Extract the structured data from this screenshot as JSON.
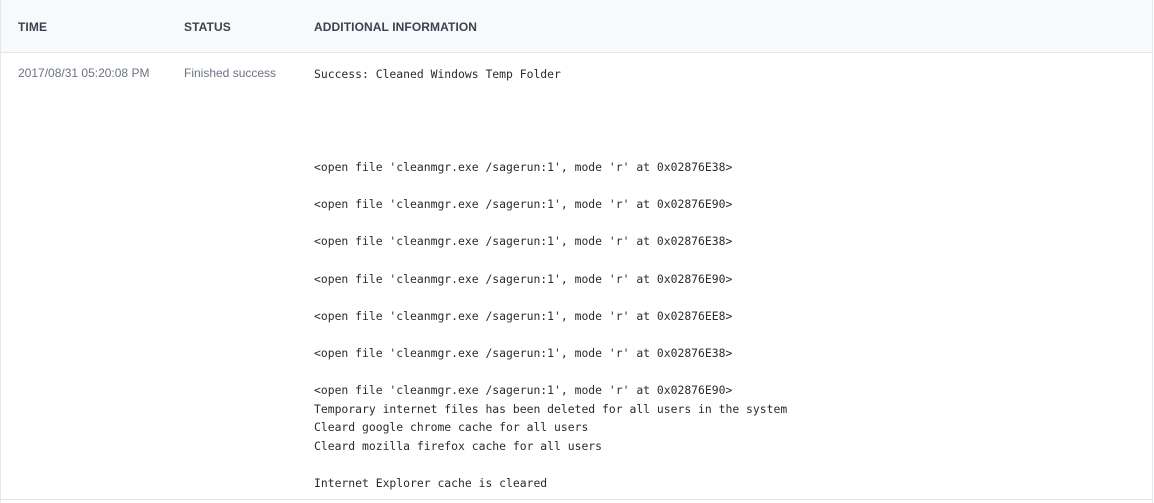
{
  "table": {
    "headers": {
      "time": "TIME",
      "status": "STATUS",
      "additional_information": "ADDITIONAL INFORMATION"
    },
    "rows": [
      {
        "time": "2017/08/31 05:20:08 PM",
        "status": "Finished success",
        "additional_information_lines": [
          "Success: Cleaned Windows Temp Folder",
          "",
          "",
          "",
          "",
          "<open file 'cleanmgr.exe /sagerun:1', mode 'r' at 0x02876E38>",
          "",
          "<open file 'cleanmgr.exe /sagerun:1', mode 'r' at 0x02876E90>",
          "",
          "<open file 'cleanmgr.exe /sagerun:1', mode 'r' at 0x02876E38>",
          "",
          "<open file 'cleanmgr.exe /sagerun:1', mode 'r' at 0x02876E90>",
          "",
          "<open file 'cleanmgr.exe /sagerun:1', mode 'r' at 0x02876EE8>",
          "",
          "<open file 'cleanmgr.exe /sagerun:1', mode 'r' at 0x02876E38>",
          "",
          "<open file 'cleanmgr.exe /sagerun:1', mode 'r' at 0x02876E90>",
          "Temporary internet files has been deleted for all users in the system",
          "Cleard google chrome cache for all users",
          "Cleard mozilla firefox cache for all users",
          "",
          "Internet Explorer cache is cleared"
        ]
      }
    ]
  }
}
